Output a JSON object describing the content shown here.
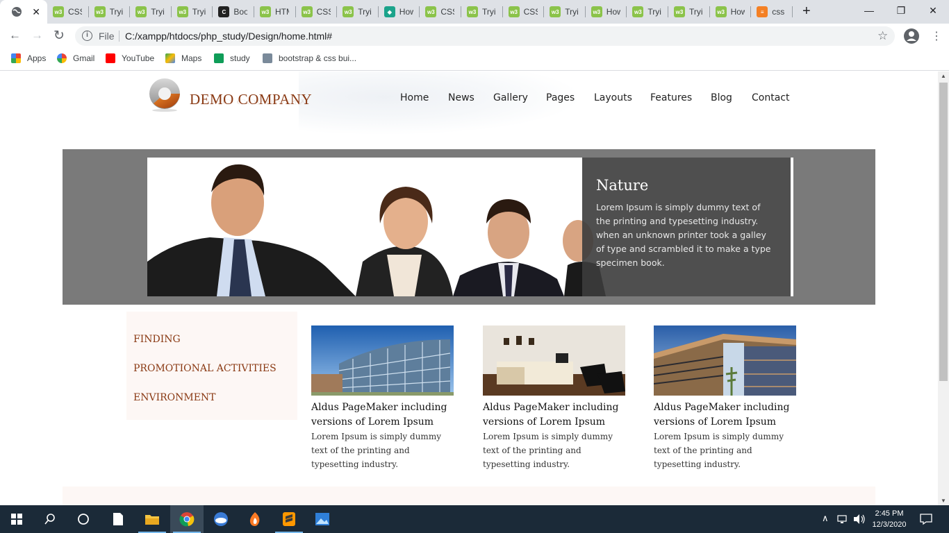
{
  "browser": {
    "tabs": [
      {
        "label": "",
        "icon": "globe-icon",
        "active": true
      },
      {
        "label": "CSS",
        "icon": "w3schools-icon"
      },
      {
        "label": "Tryi",
        "icon": "w3schools-icon"
      },
      {
        "label": "Tryi",
        "icon": "w3schools-icon"
      },
      {
        "label": "Tryi",
        "icon": "w3schools-icon"
      },
      {
        "label": "Boo",
        "icon": "codepen-icon"
      },
      {
        "label": "HTM",
        "icon": "w3schools-icon"
      },
      {
        "label": "CSS",
        "icon": "w3schools-icon"
      },
      {
        "label": "Tryi",
        "icon": "w3schools-icon"
      },
      {
        "label": "How",
        "icon": "hexagon-icon"
      },
      {
        "label": "CSS",
        "icon": "w3schools-icon"
      },
      {
        "label": "Tryi",
        "icon": "w3schools-icon"
      },
      {
        "label": "CSS",
        "icon": "w3schools-icon"
      },
      {
        "label": "Tryi",
        "icon": "w3schools-icon"
      },
      {
        "label": "How",
        "icon": "w3schools-icon"
      },
      {
        "label": "Tryi",
        "icon": "w3schools-icon"
      },
      {
        "label": "Tryi",
        "icon": "w3schools-icon"
      },
      {
        "label": "How",
        "icon": "w3schools-icon"
      },
      {
        "label": "css",
        "icon": "stackoverflow-icon"
      }
    ],
    "new_tab": "+",
    "window": {
      "minimize": "—",
      "restore": "❐",
      "close": "✕"
    },
    "nav": {
      "back": "←",
      "forward": "→",
      "reload": "↻"
    },
    "address": {
      "scheme_label": "File",
      "url": "C:/xampp/htdocs/php_study/Design/home.html#"
    },
    "bookmarks": [
      {
        "label": "Apps",
        "icon": "apps-grid-icon"
      },
      {
        "label": "Gmail",
        "icon": "google-icon"
      },
      {
        "label": "YouTube",
        "icon": "youtube-icon"
      },
      {
        "label": "Maps",
        "icon": "maps-icon"
      },
      {
        "label": "study",
        "icon": "plus-icon"
      },
      {
        "label": "bootstrap & css bui...",
        "icon": "cube-icon"
      }
    ]
  },
  "site": {
    "logo_text": "DEMO COMPANY",
    "menu": [
      "Home",
      "News",
      "Gallery",
      "Pages",
      "Layouts",
      "Features",
      "Blog",
      "Contact"
    ],
    "slide": {
      "title": "Nature",
      "text": "Lorem Ipsum is simply dummy text of the printing and typesetting industry. when an unknown printer took a galley of type and scrambled it to make a type specimen book."
    },
    "sidebar_links": [
      "FINDING",
      "PROMOTIONAL ACTIVITIES",
      "ENVIRONMENT"
    ],
    "cards": [
      {
        "title": "Aldus PageMaker including versions of Lorem Ipsum",
        "text": "Lorem Ipsum is simply dummy text of the printing and typesetting industry."
      },
      {
        "title": "Aldus PageMaker including versions of Lorem Ipsum",
        "text": "Lorem Ipsum is simply dummy text of the printing and typesetting industry."
      },
      {
        "title": "Aldus PageMaker including versions of Lorem Ipsum",
        "text": "Lorem Ipsum is simply dummy text of the printing and typesetting industry."
      }
    ]
  },
  "taskbar": {
    "time": "2:45 PM",
    "date": "12/3/2020"
  }
}
